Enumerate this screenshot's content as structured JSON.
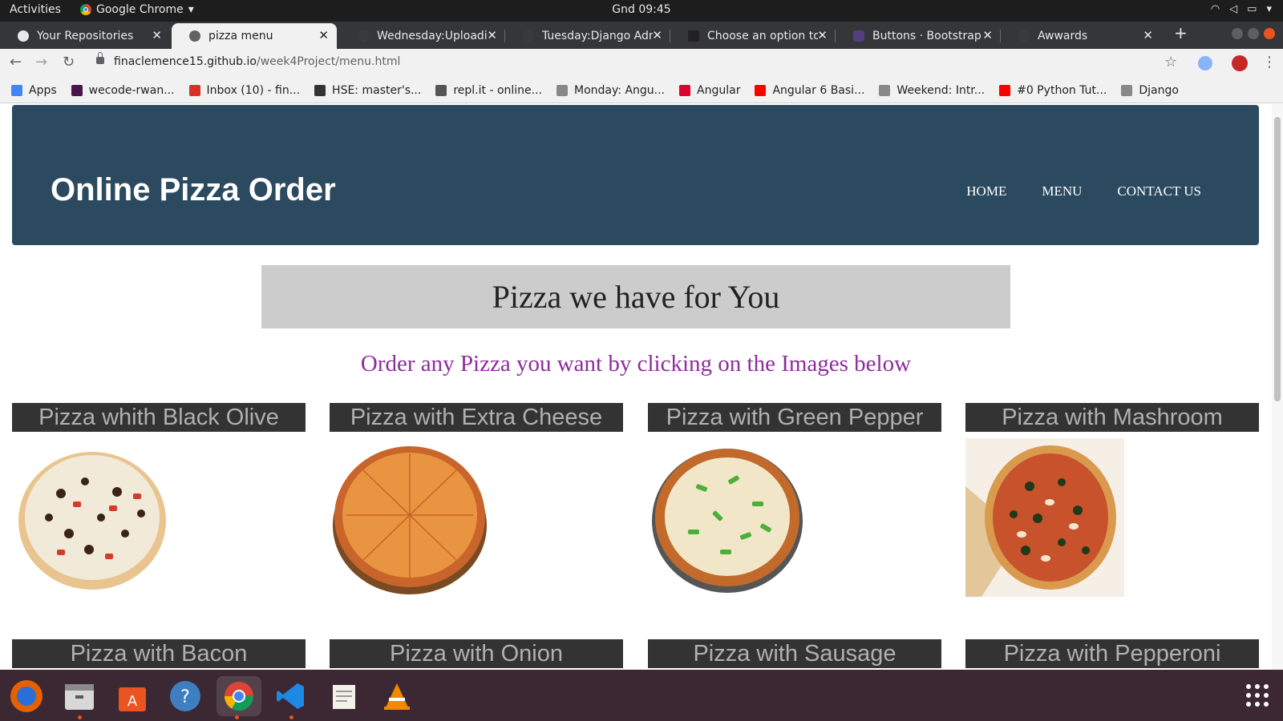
{
  "system_bar": {
    "activities": "Activities",
    "app_name": "Google Chrome",
    "clock": "Gnd 09:45"
  },
  "tabs": [
    {
      "label": "Your Repositories",
      "active": false,
      "icon": "github-icon"
    },
    {
      "label": "pizza menu",
      "active": true,
      "icon": "globe-icon"
    },
    {
      "label": "Wednesday:Uploadin",
      "active": false,
      "icon": "moringa-icon"
    },
    {
      "label": "Tuesday:Django Adm",
      "active": false,
      "icon": "moringa-icon"
    },
    {
      "label": "Choose an option to",
      "active": false,
      "icon": "w-icon"
    },
    {
      "label": "Buttons · Bootstrap",
      "active": false,
      "icon": "bootstrap-icon"
    },
    {
      "label": "Awwards",
      "active": false,
      "icon": "awwards-icon"
    }
  ],
  "address": {
    "domain": "finaclemence15.github.io",
    "path": "/week4Project/menu.html"
  },
  "bookmarks": [
    {
      "label": "Apps",
      "icon": "apps-grid-icon",
      "color": "#4285f4"
    },
    {
      "label": "wecode-rwan...",
      "icon": "slack-icon",
      "color": "#4a154b"
    },
    {
      "label": "Inbox (10) - fin...",
      "icon": "gmail-icon",
      "color": "#d93025"
    },
    {
      "label": "HSE: master's...",
      "icon": "hse-icon",
      "color": "#333333"
    },
    {
      "label": "repl.it - online...",
      "icon": "replit-icon",
      "color": "#555555"
    },
    {
      "label": "Monday: Angu...",
      "icon": "moringa-icon",
      "color": "#888888"
    },
    {
      "label": "Angular",
      "icon": "angular-icon",
      "color": "#dd0031"
    },
    {
      "label": "Angular 6 Basi...",
      "icon": "youtube-icon",
      "color": "#ff0000"
    },
    {
      "label": "Weekend: Intr...",
      "icon": "moringa-icon",
      "color": "#888888"
    },
    {
      "label": "#0 Python Tut...",
      "icon": "youtube-icon",
      "color": "#ff0000"
    },
    {
      "label": "Django",
      "icon": "moringa-icon",
      "color": "#888888"
    }
  ],
  "header": {
    "title": "Online Pizza Order",
    "nav": [
      "HOME",
      "MENU",
      "CONTACT US"
    ]
  },
  "banner": {
    "heading": "Pizza we have for You",
    "subtitle": "Order any Pizza you want by clicking on the Images below"
  },
  "pizzas_row1": [
    {
      "title": "Pizza whith Black Olive"
    },
    {
      "title": "Pizza with Extra Cheese"
    },
    {
      "title": "Pizza with Green Pepper"
    },
    {
      "title": "Pizza with Mashroom"
    }
  ],
  "pizzas_row2": [
    {
      "title": "Pizza with Bacon"
    },
    {
      "title": "Pizza with Onion"
    },
    {
      "title": "Pizza with Sausage"
    },
    {
      "title": "Pizza with Pepperoni"
    }
  ],
  "colors": {
    "header_bg": "#2b4a5f",
    "subtitle": "#8e2c9c",
    "card_title_bg": "#333333",
    "banner_bg": "#cccccc"
  }
}
